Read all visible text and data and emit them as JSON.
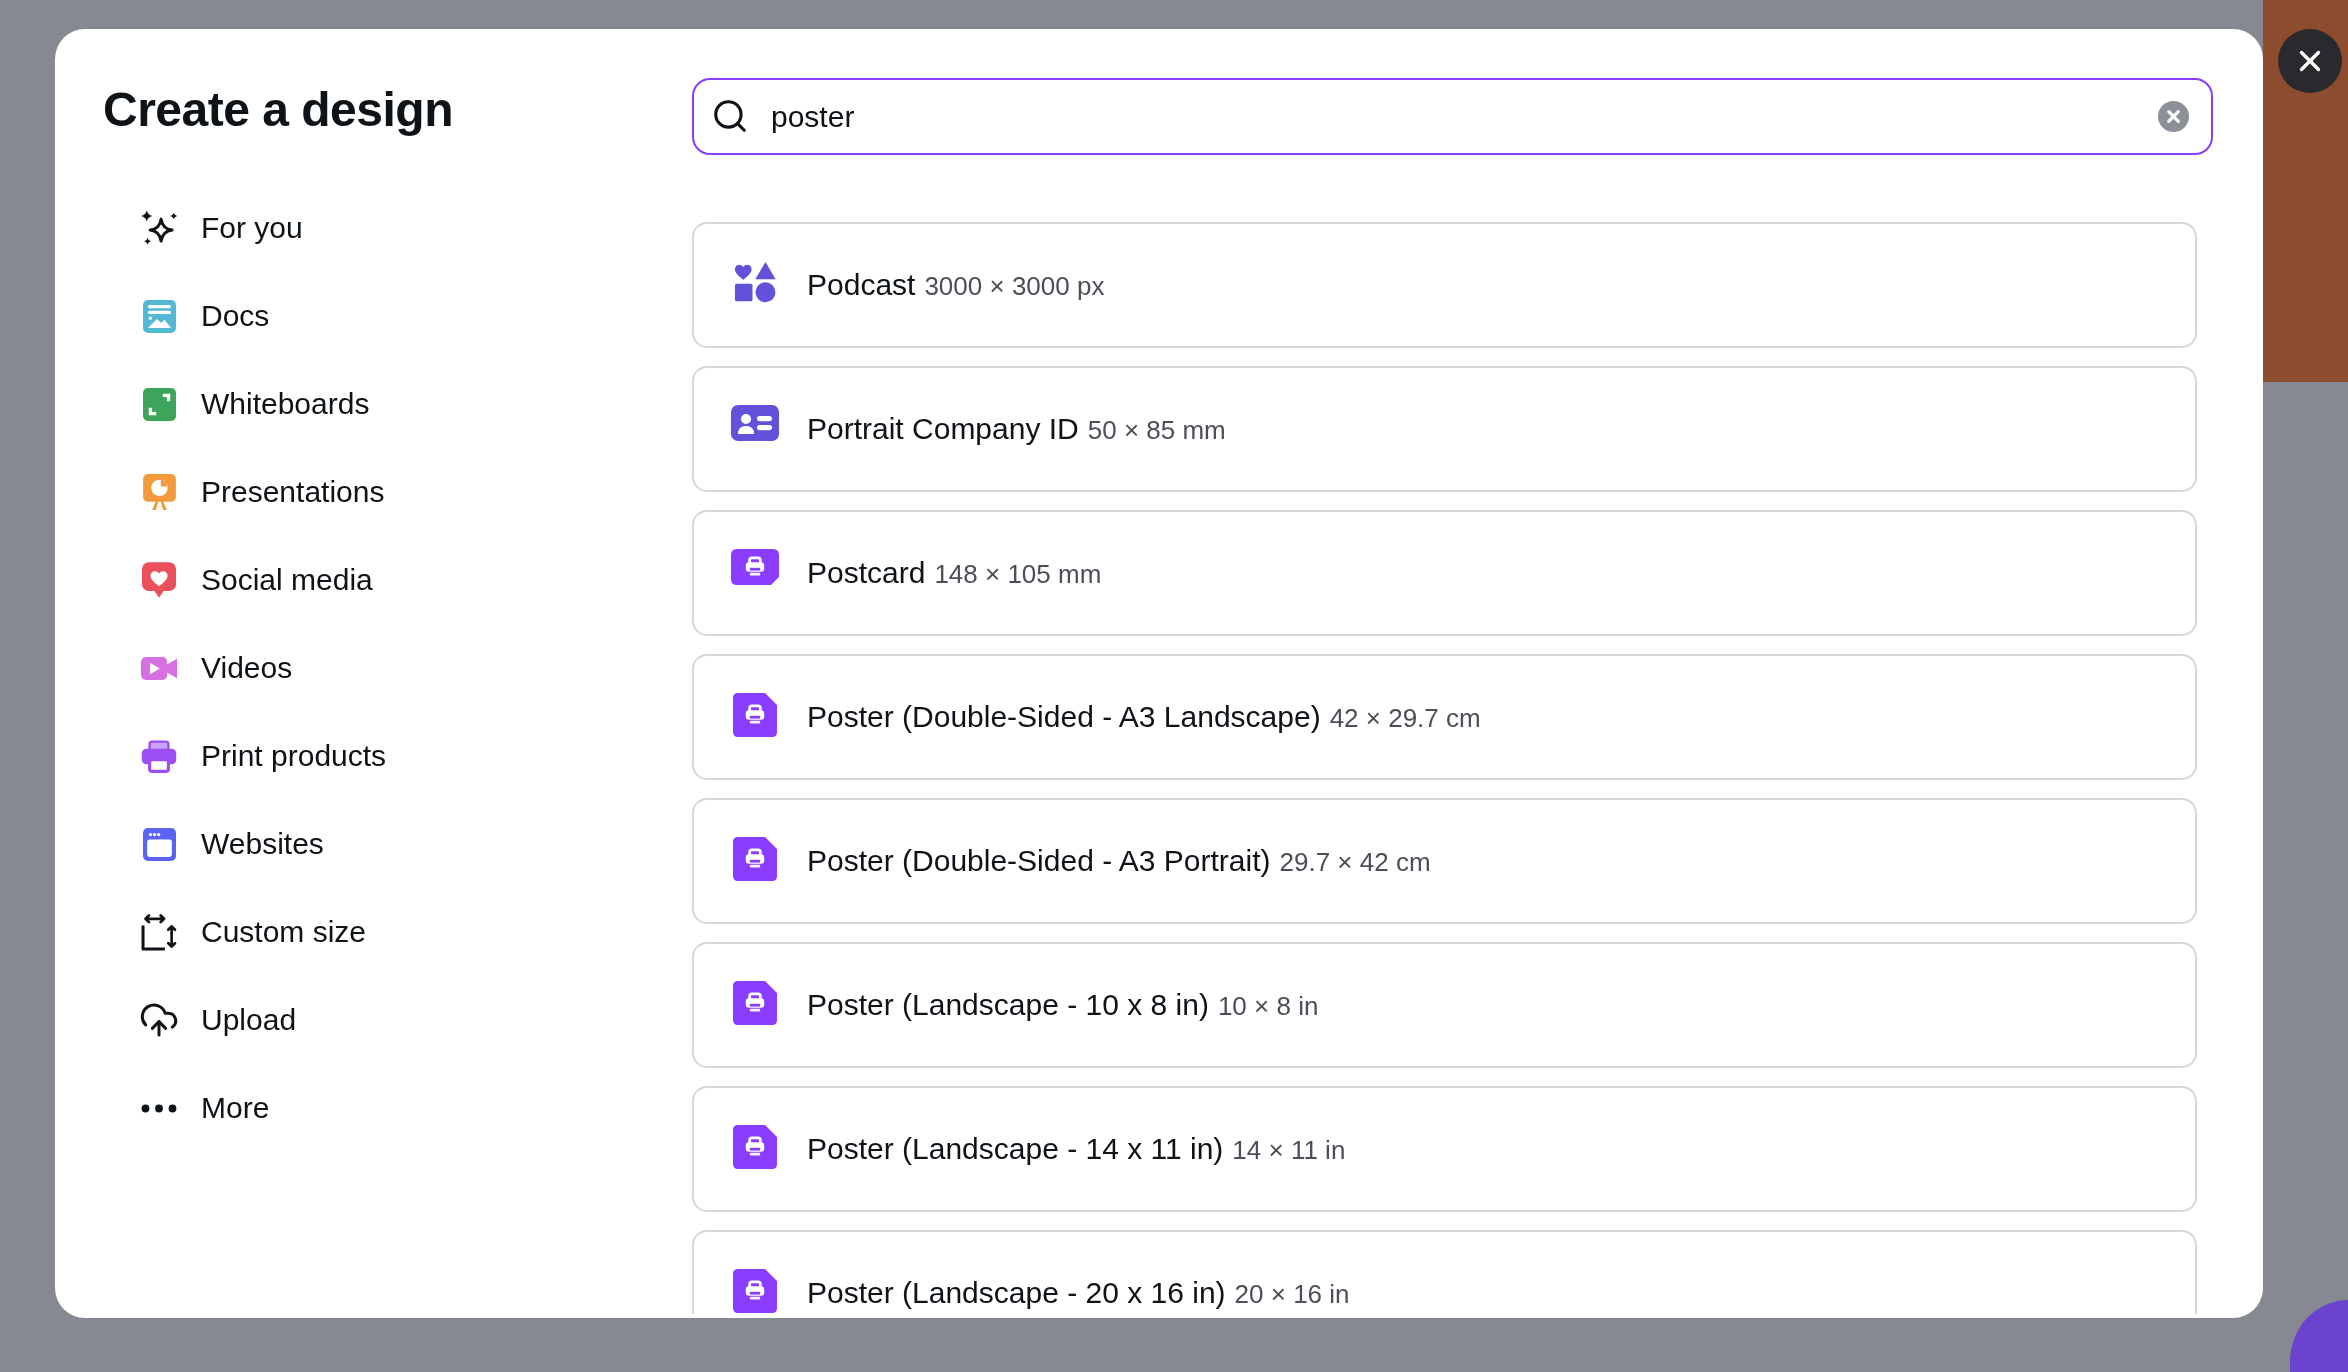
{
  "dialog": {
    "title": "Create a design"
  },
  "sidebar": {
    "items": [
      {
        "label": "For you",
        "kind": "sparkles"
      },
      {
        "label": "Docs",
        "kind": "docs"
      },
      {
        "label": "Whiteboards",
        "kind": "whiteboard"
      },
      {
        "label": "Presentations",
        "kind": "presentation"
      },
      {
        "label": "Social media",
        "kind": "social"
      },
      {
        "label": "Videos",
        "kind": "video"
      },
      {
        "label": "Print products",
        "kind": "print"
      },
      {
        "label": "Websites",
        "kind": "website"
      },
      {
        "label": "Custom size",
        "kind": "resize"
      },
      {
        "label": "Upload",
        "kind": "upload"
      },
      {
        "label": "More",
        "kind": "more"
      }
    ]
  },
  "search": {
    "value": "poster"
  },
  "results": [
    {
      "name": "Podcast",
      "size": "3000 × 3000 px",
      "kind": "shapes"
    },
    {
      "name": "Portrait Company ID",
      "size": "50 × 85 mm",
      "kind": "badge"
    },
    {
      "name": "Postcard",
      "size": "148 × 105 mm",
      "kind": "postcard"
    },
    {
      "name": "Poster (Double-Sided - A3 Landscape)",
      "size": "42 × 29.7 cm",
      "kind": "poster"
    },
    {
      "name": "Poster (Double-Sided - A3 Portrait)",
      "size": "29.7 × 42 cm",
      "kind": "poster"
    },
    {
      "name": "Poster (Landscape - 10 x 8 in)",
      "size": "10 × 8 in",
      "kind": "poster"
    },
    {
      "name": "Poster (Landscape - 14 x 11 in)",
      "size": "14 × 11 in",
      "kind": "poster"
    },
    {
      "name": "Poster (Landscape - 20 x 16 in)",
      "size": "20 × 16 in",
      "kind": "poster"
    }
  ]
}
